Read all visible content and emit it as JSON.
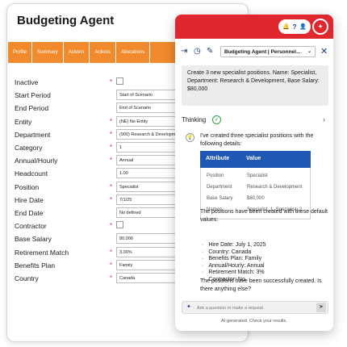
{
  "app": {
    "title": "Budgeting Agent",
    "tabs": [
      "Profile",
      "Summary",
      "Actions",
      "Actions",
      "Allocations"
    ]
  },
  "form": {
    "rows": [
      {
        "label": "Inactive",
        "required": true,
        "type": "checkbox",
        "value": ""
      },
      {
        "label": "Start Period",
        "required": false,
        "type": "text",
        "value": "Start of Scenario"
      },
      {
        "label": "End Period",
        "required": false,
        "type": "text",
        "value": "End of Scenario"
      },
      {
        "label": "Entity",
        "required": true,
        "type": "text",
        "value": "(NE) No Entity"
      },
      {
        "label": "Department",
        "required": true,
        "type": "text",
        "value": "(900) Research & Development"
      },
      {
        "label": "Category",
        "required": true,
        "type": "text",
        "value": "1"
      },
      {
        "label": "Annual/Hourly",
        "required": true,
        "type": "text",
        "value": "Annual"
      },
      {
        "label": "Headcount",
        "required": false,
        "type": "text",
        "value": "1.00"
      },
      {
        "label": "Position",
        "required": true,
        "type": "text",
        "value": "Specialist"
      },
      {
        "label": "Hire Date",
        "required": true,
        "type": "text",
        "value": "7/1/25"
      },
      {
        "label": "End Date",
        "required": false,
        "type": "text",
        "value": "No defined"
      },
      {
        "label": "Contractor",
        "required": true,
        "type": "checkbox",
        "value": ""
      },
      {
        "label": "Base Salary",
        "required": false,
        "type": "text",
        "value": "80,000"
      },
      {
        "label": "Retirement Match",
        "required": true,
        "type": "text",
        "value": "3.00%"
      },
      {
        "label": "Benefits Plan",
        "required": true,
        "type": "text",
        "value": "Family"
      },
      {
        "label": "Country",
        "required": true,
        "type": "text",
        "value": "Canada"
      }
    ]
  },
  "chat": {
    "header": {
      "bell": "🔔",
      "help": "?",
      "user": "👤",
      "logo": "✦"
    },
    "toolbar": {
      "login_icon": "⇥",
      "history_icon": "◷",
      "edit_icon": "✎",
      "agent_selected": "Budgeting Agent | Personnel...",
      "caret": "⌄",
      "close": "✕"
    },
    "user_message": "Create 3 new specialist positions. Name: Specialist, Department: Research & Development, Base Salary: $80,000",
    "thinking_label": "Thinking",
    "thinking_check": "✓",
    "thinking_chevron": "›",
    "bulb": "💡",
    "reply_intro": "I've created three specialist positions with the following details:",
    "table": {
      "headers": [
        "Attribute",
        "Value"
      ],
      "rows": [
        [
          "Position",
          "Specialist"
        ],
        [
          "Department",
          "Research & Development"
        ],
        [
          "Base Salary",
          "$80,000"
        ],
        [
          "Names",
          "Specialist_1, Specialist_2"
        ]
      ]
    },
    "defaults_intro": "The positions have been created with these default values:",
    "defaults": [
      "Hire Date: July 1, 2025",
      "Country: Canada",
      "Benefits Plan: Family",
      "Annual/Hourly: Annual",
      "Retirement Match: 3%",
      "Contractor: No"
    ],
    "closing": "The positions have been successfully created. Is there anything else?",
    "input_placeholder": "Ask a question or make a request.",
    "sparkle": "✦",
    "send": "➤",
    "footer": "AI-generated. Check your results."
  }
}
